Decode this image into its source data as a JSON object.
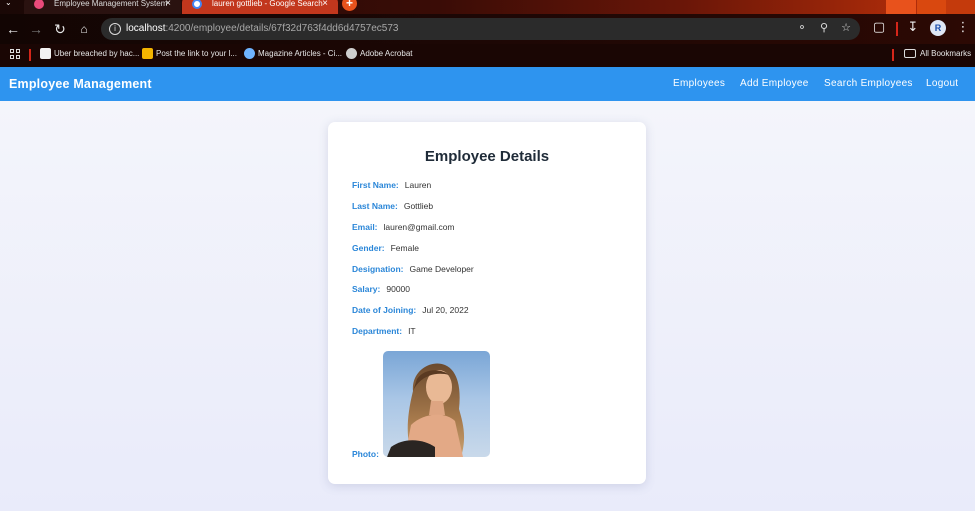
{
  "browser": {
    "tabs": [
      {
        "title": "Employee Management System",
        "active": false
      },
      {
        "title": "lauren gottlieb - Google Search",
        "active": true
      }
    ],
    "url_host": "localhost",
    "url_path": ":4200/employee/details/67f32d763f4dd6d4757ec573",
    "bookmarks": [
      "Uber breached by hac...",
      "Post the link to your l...",
      "Magazine Articles - Ci...",
      "Adobe Acrobat"
    ],
    "all_bookmarks_label": "All Bookmarks",
    "profile_initial": "R"
  },
  "header": {
    "brand": "Employee Management",
    "nav": [
      "Employees",
      "Add Employee",
      "Search Employees",
      "Logout"
    ]
  },
  "card": {
    "title": "Employee Details",
    "fields": [
      {
        "label": "First Name:",
        "value": "Lauren"
      },
      {
        "label": "Last Name:",
        "value": "Gottlieb"
      },
      {
        "label": "Email:",
        "value": "lauren@gmail.com"
      },
      {
        "label": "Gender:",
        "value": "Female"
      },
      {
        "label": "Designation:",
        "value": "Game Developer"
      },
      {
        "label": "Salary:",
        "value": "90000"
      },
      {
        "label": "Date of Joining:",
        "value": "Jul 20, 2022"
      },
      {
        "label": "Department:",
        "value": "IT"
      }
    ],
    "photo_label": "Photo:"
  },
  "colors": {
    "header_bg": "#2e94ef",
    "label_color": "#2a86d8",
    "title_color": "#1f2b38"
  }
}
